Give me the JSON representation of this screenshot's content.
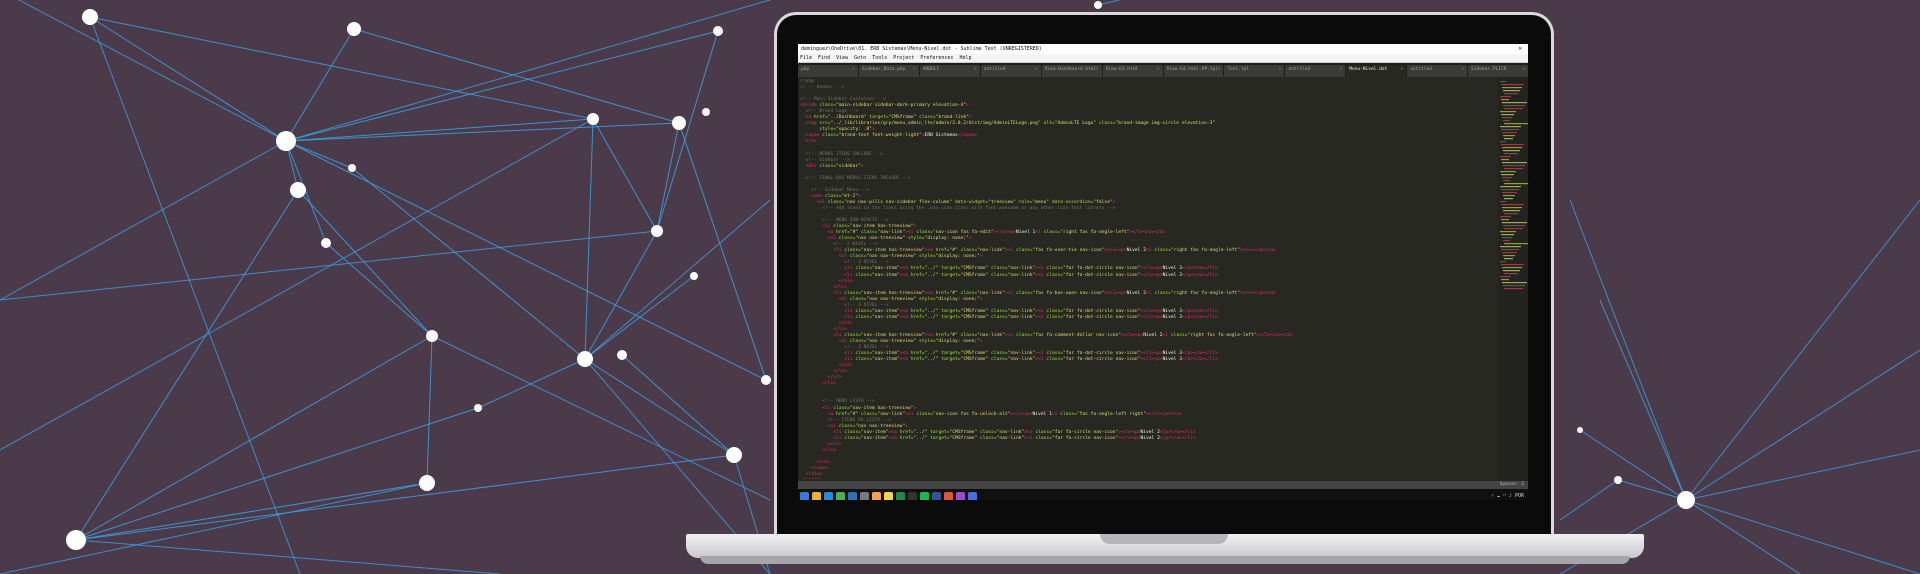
{
  "window": {
    "title": "deminguez\\OneDrive\\01. ERB Sistemas\\Menu-Nivel.dot - Sublime Text (UNREGISTERED)",
    "close_glyph": "✕"
  },
  "menu": [
    "File",
    "Find",
    "View",
    "Goto",
    "Tools",
    "Project",
    "Preferences",
    "Help"
  ],
  "tabs": [
    {
      "label": "php",
      "active": false
    },
    {
      "label": "Sidebar_Data.php",
      "active": false
    },
    {
      "label": "ARBOL1",
      "active": false
    },
    {
      "label": "untitled",
      "active": false
    },
    {
      "label": "View-Dashboard.html",
      "active": false
    },
    {
      "label": "View-Ed.html",
      "active": false
    },
    {
      "label": "View-Ed.html.PP.tpl",
      "active": false
    },
    {
      "label": "Test.tpl",
      "active": false
    },
    {
      "label": "untitled",
      "active": false
    },
    {
      "label": "Menu-Nivel.dot",
      "active": true
    },
    {
      "label": "untitled",
      "active": false
    },
    {
      "label": "Sidebar.PLICK",
      "active": false
    }
  ],
  "status": {
    "left": "",
    "right": "Spaces: 2"
  },
  "tray": {
    "lang": "POR"
  },
  "colors": {
    "background": "#4b3a4a",
    "network_lines": "#3aa2e8",
    "editor_bg": "#272822"
  }
}
